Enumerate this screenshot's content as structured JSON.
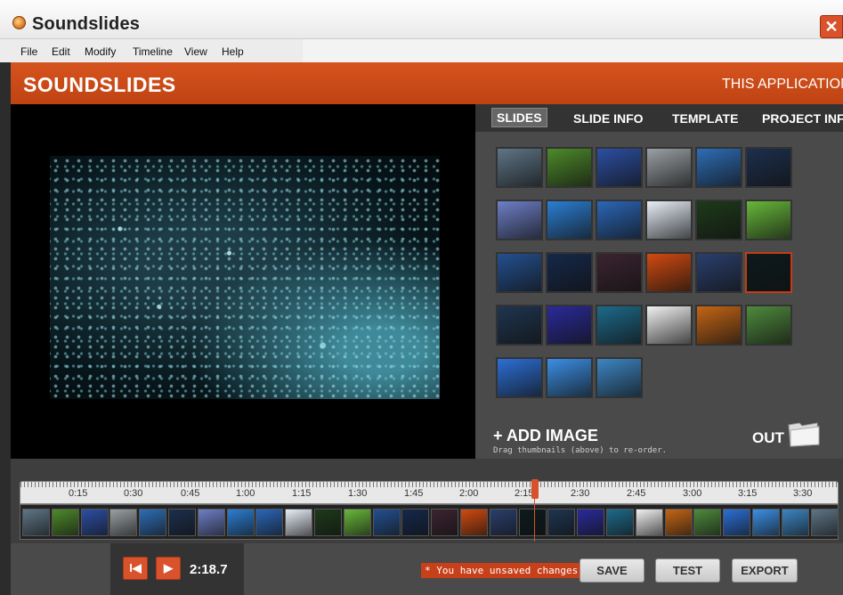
{
  "window": {
    "title": "Soundslides",
    "close_glyph": "✕",
    "icon": "soundslides-app-icon"
  },
  "menu": [
    "File",
    "Edit",
    "Modify",
    "Timeline",
    "View",
    "Help"
  ],
  "header": {
    "brand": "SOUNDSLIDES",
    "notice": "THIS APPLICATION IS N"
  },
  "tabs": [
    "SLIDES",
    "SLIDE INFO",
    "TEMPLATE",
    "PROJECT INFO"
  ],
  "active_tab": "SLIDES",
  "thumbnail_colors": [
    "#5e7586",
    "#4d8a2a",
    "#2c4fa3",
    "#9aa0a4",
    "#2d6db5",
    "#1c2f4d",
    "#6d7fc7",
    "#2b7ed3",
    "#2b66b8",
    "#e8eef8",
    "#1d3a1a",
    "#67b83a",
    "#23508f",
    "#14284a",
    "#3b2430",
    "#d04a10",
    "#2a3f6e",
    "#0d1a1c",
    "#1e3550",
    "#2a2a9a",
    "#1d6a8a",
    "#f1f1f1",
    "#c46515",
    "#4e8a3c",
    "#2c6fd6",
    "#3b8fe5",
    "#3c86c3"
  ],
  "selected_thumbnail": 17,
  "add_image": {
    "label": "+ ADD IMAGE",
    "hint": "Drag thumbnails (above) to re-order."
  },
  "out": {
    "label": "OUT",
    "icon": "folder-icon"
  },
  "timeline": {
    "labels": [
      "0:15",
      "0:30",
      "0:45",
      "1:00",
      "1:15",
      "1:30",
      "1:45",
      "2:00",
      "2:15",
      "2:30",
      "2:45",
      "3:00",
      "3:15",
      "3:30"
    ],
    "current_time": "2:18.7"
  },
  "transport": {
    "rewind_glyph": "I◀",
    "play_glyph": "▶"
  },
  "status": {
    "unsaved": "* You have unsaved changes."
  },
  "buttons": {
    "save": "SAVE",
    "test": "TEST",
    "export": "EXPORT"
  },
  "colors": {
    "accent": "#d4521e",
    "panel": "#4a4a4a",
    "background": "#3a3a3a"
  }
}
